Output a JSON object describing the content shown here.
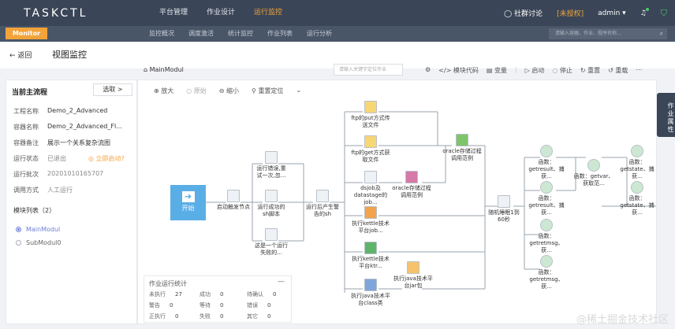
{
  "app": {
    "logo": "TASKCTL"
  },
  "nav": [
    {
      "label": "平台管理"
    },
    {
      "label": "作业设计"
    },
    {
      "label": "运行监控"
    }
  ],
  "top_right": {
    "community": "社群讨论",
    "auth": "[未授权]",
    "user": "admin ▾"
  },
  "subbar": {
    "monitor": "Monitor",
    "items": [
      "监控概况",
      "调度激活",
      "统计监控",
      "作业列表",
      "运行分析"
    ],
    "search_placeholder": "请输入容器、作业、程序名称..."
  },
  "header": {
    "back": "← 返回",
    "title": "视图监控"
  },
  "main_head": {
    "module": "MainModul",
    "search_placeholder": "请输入关键字定位作业"
  },
  "toolbar": [
    "模块代码",
    "变量",
    "启动",
    "停止",
    "重置",
    "重载",
    "⋯"
  ],
  "canvas_tools": [
    "放大",
    "原始",
    "缩小",
    "重置定位"
  ],
  "left": {
    "title": "当前主流程",
    "select": "选取 >",
    "rows": [
      {
        "label": "工程名称",
        "value": "Demo_2_Advanced"
      },
      {
        "label": "容器名称",
        "value": "Demo_2_Advanced_Fl..."
      },
      {
        "label": "容器备注",
        "value": "展示一个关系复杂流图"
      },
      {
        "label": "运行状态",
        "value": "已退出"
      },
      {
        "label": "运行批次",
        "value": "20201010165707"
      },
      {
        "label": "调用方式",
        "value": "人工运行"
      }
    ],
    "restart": "◎ 立即启动?",
    "module_list_title": "模块列表（2）",
    "modules": [
      "MainModul",
      "SubModul0"
    ]
  },
  "nodes": {
    "start": "开始",
    "n1": "启动触发节点",
    "n2": "运行错误,重试一次,忽...",
    "n3": "运行成功的sh脚本",
    "n4": "这是一个运行失败的...",
    "n5": "运行后产生警告的sh",
    "n6": "ftp的put方式传送文件",
    "n7": "ftp的get方式获取文件",
    "n8": "dsjob及datastage的job...",
    "n9": "oracle存储过程调用范例",
    "n10": "oracle存储过程调用范例",
    "n11": "执行kettle技术平台job...",
    "n12": "执行kettle技术平台ktr...",
    "n13": "执行java技术平台class类",
    "n14": "执行java技术平台jar包",
    "n15": "随机睡眠1到60秒",
    "n16": "函数：getresult、捕获...",
    "n17": "函数：getvar、获取范...",
    "n18": "函数：getstate、捕获...",
    "n19": "函数：getresult、捕获...",
    "n20": "函数：getstate、捕获...",
    "n21": "函数：getretmsg、获...",
    "n22": "函数：getretmsg、获..."
  },
  "stats": {
    "title": "作业运行统计",
    "cells": [
      {
        "label": "未执行",
        "value": "27"
      },
      {
        "label": "成功",
        "value": "0"
      },
      {
        "label": "待确认",
        "value": "0"
      },
      {
        "label": "警告",
        "value": "0"
      },
      {
        "label": "等待",
        "value": "0"
      },
      {
        "label": "错误",
        "value": "0"
      },
      {
        "label": "正执行",
        "value": "0"
      },
      {
        "label": "失败",
        "value": "0"
      },
      {
        "label": "其它",
        "value": "0"
      }
    ]
  },
  "side_tab": "作业属性",
  "watermark": "@稀土掘金技术社区",
  "colors": {
    "topbar": "#3a4557",
    "accent": "#f2a33a",
    "start": "#5aaee6"
  }
}
